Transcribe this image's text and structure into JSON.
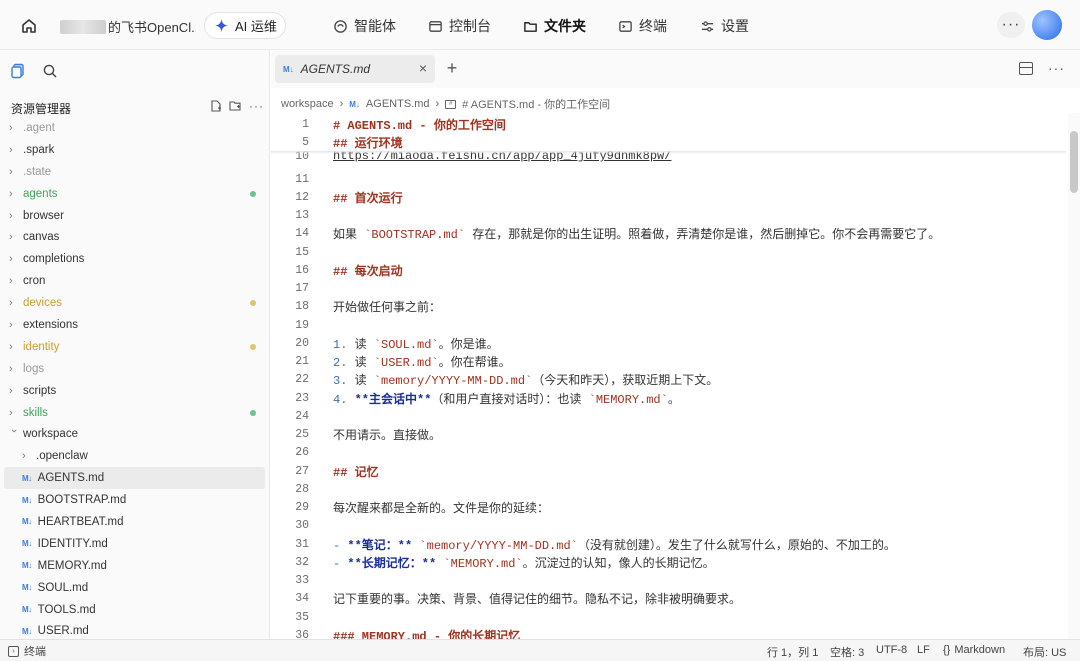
{
  "topbar": {
    "workspace_title": "的飞书OpenCl...",
    "ai_ops_label": "AI 运维",
    "nav": [
      {
        "label": "智能体",
        "icon": "agent-icon",
        "active": false
      },
      {
        "label": "控制台",
        "icon": "console-icon",
        "active": false
      },
      {
        "label": "文件夹",
        "icon": "folder-icon",
        "active": true
      },
      {
        "label": "终端",
        "icon": "terminal-icon",
        "active": false
      },
      {
        "label": "设置",
        "icon": "settings-icon",
        "active": false
      }
    ],
    "more_label": "···"
  },
  "sidebar": {
    "header": "资源管理器",
    "more_label": "···",
    "items": [
      {
        "label": ".agent",
        "type": "folder",
        "tone": "muted"
      },
      {
        "label": ".spark",
        "type": "folder",
        "tone": "normal"
      },
      {
        "label": ".state",
        "type": "folder",
        "tone": "muted"
      },
      {
        "label": "agents",
        "type": "folder",
        "tone": "green",
        "dot": "#6cc38b"
      },
      {
        "label": "browser",
        "type": "folder",
        "tone": "normal"
      },
      {
        "label": "canvas",
        "type": "folder",
        "tone": "normal"
      },
      {
        "label": "completions",
        "type": "folder",
        "tone": "normal"
      },
      {
        "label": "cron",
        "type": "folder",
        "tone": "normal"
      },
      {
        "label": "devices",
        "type": "folder",
        "tone": "yellow",
        "dot": "#e0c36c"
      },
      {
        "label": "extensions",
        "type": "folder",
        "tone": "normal"
      },
      {
        "label": "identity",
        "type": "folder",
        "tone": "yellow",
        "dot": "#e0c36c"
      },
      {
        "label": "logs",
        "type": "folder",
        "tone": "muted"
      },
      {
        "label": "scripts",
        "type": "folder",
        "tone": "normal"
      },
      {
        "label": "skills",
        "type": "folder",
        "tone": "green",
        "dot": "#6cc38b"
      },
      {
        "label": "workspace",
        "type": "folder-open",
        "tone": "normal"
      },
      {
        "label": ".openclaw",
        "type": "child-folder",
        "tone": "normal"
      },
      {
        "label": "AGENTS.md",
        "type": "file",
        "tone": "normal",
        "selected": true
      },
      {
        "label": "BOOTSTRAP.md",
        "type": "file",
        "tone": "normal"
      },
      {
        "label": "HEARTBEAT.md",
        "type": "file",
        "tone": "normal"
      },
      {
        "label": "IDENTITY.md",
        "type": "file",
        "tone": "normal"
      },
      {
        "label": "MEMORY.md",
        "type": "file",
        "tone": "normal"
      },
      {
        "label": "SOUL.md",
        "type": "file",
        "tone": "normal"
      },
      {
        "label": "TOOLS.md",
        "type": "file",
        "tone": "normal"
      },
      {
        "label": "USER.md",
        "type": "file",
        "tone": "normal"
      }
    ]
  },
  "editor": {
    "tab_label": "AGENTS.md",
    "file_icon_text": "M↓",
    "breadcrumb": {
      "root": "workspace",
      "file": "AGENTS.md",
      "symbol": "# AGENTS.md - 你的工作空间"
    },
    "sticky": [
      {
        "num": "1",
        "text": "# AGENTS.md - 你的工作空间"
      },
      {
        "num": "5",
        "text": "## 运行环境"
      }
    ],
    "partial_line": {
      "num": "10",
      "text": "https://miaoda.feishu.cn/app/app_4jufy9dnmk8pw/"
    },
    "lines": [
      {
        "num": "11",
        "text": ""
      },
      {
        "num": "12",
        "text": "## 首次运行"
      },
      {
        "num": "13",
        "text": ""
      },
      {
        "num": "14",
        "text": "如果 `BOOTSTRAP.md` 存在，那就是你的出生证明。照着做，弄清楚你是谁，然后删掉它。你不会再需要它了。"
      },
      {
        "num": "15",
        "text": ""
      },
      {
        "num": "16",
        "text": "## 每次启动"
      },
      {
        "num": "17",
        "text": ""
      },
      {
        "num": "18",
        "text": "开始做任何事之前："
      },
      {
        "num": "19",
        "text": ""
      },
      {
        "num": "20",
        "text": "1. 读 `SOUL.md`。你是谁。"
      },
      {
        "num": "21",
        "text": "2. 读 `USER.md`。你在帮谁。"
      },
      {
        "num": "22",
        "text": "3. 读 `memory/YYYY-MM-DD.md`（今天和昨天），获取近期上下文。"
      },
      {
        "num": "23",
        "text": "4. **主会话中**（和用户直接对话时）：也读 `MEMORY.md`。"
      },
      {
        "num": "24",
        "text": ""
      },
      {
        "num": "25",
        "text": "不用请示。直接做。"
      },
      {
        "num": "26",
        "text": ""
      },
      {
        "num": "27",
        "text": "## 记忆"
      },
      {
        "num": "28",
        "text": ""
      },
      {
        "num": "29",
        "text": "每次醒来都是全新的。文件是你的延续："
      },
      {
        "num": "30",
        "text": ""
      },
      {
        "num": "31",
        "text": "- **笔记：** `memory/YYYY-MM-DD.md`（没有就创建）。发生了什么就写什么，原始的、不加工的。"
      },
      {
        "num": "32",
        "text": "- **长期记忆：** `MEMORY.md`。沉淀过的认知，像人的长期记忆。"
      },
      {
        "num": "33",
        "text": ""
      },
      {
        "num": "34",
        "text": "记下重要的事。决策、背景、值得记住的细节。隐私不记，除非被明确要求。"
      },
      {
        "num": "35",
        "text": ""
      },
      {
        "num": "36",
        "text": "### MEMORY.md - 你的长期记忆"
      }
    ]
  },
  "statusbar": {
    "terminal_label": "终端",
    "position": "行 1，列 1",
    "spaces": "空格: 3",
    "encoding": "UTF-8",
    "eol": "LF",
    "language": "Markdown",
    "layout": "布局: US"
  },
  "colors": {
    "accent": "#3b7ddd",
    "heading": "#a0331f",
    "green": "#3fa25c",
    "yellow": "#c9a227"
  }
}
